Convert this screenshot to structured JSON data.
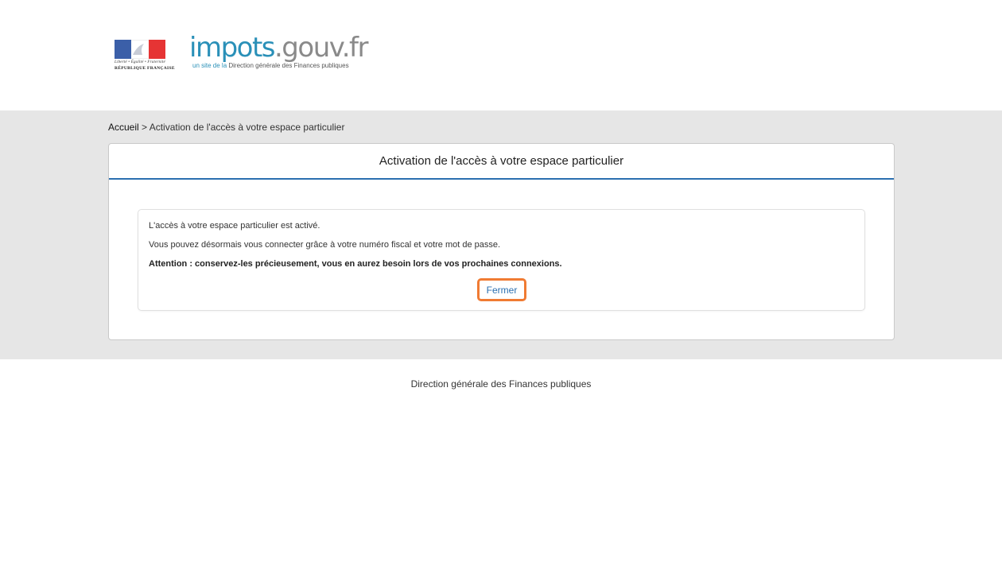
{
  "header": {
    "gov_motto": "Liberté • Égalité • Fraternité",
    "gov_name": "RÉPUBLIQUE FRANÇAISE",
    "site_name_part1": "impots",
    "site_name_part2": ".gouv.fr",
    "tagline_part1": "un site de la ",
    "tagline_part2": "Direction générale des Finances publiques"
  },
  "breadcrumb": {
    "home": "Accueil",
    "separator": " > ",
    "current": "Activation de l'accès à votre espace particulier"
  },
  "panel": {
    "title": "Activation de l'accès à votre espace particulier",
    "line1": "L'accès à votre espace particulier est activé.",
    "line2": "Vous pouvez désormais vous connecter grâce à votre numéro fiscal et votre mot de passe.",
    "line3": "Attention : conservez-les précieusement, vous en aurez besoin lors de vos prochaines connexions.",
    "close_label": "Fermer"
  },
  "footer": {
    "text": "Direction générale des Finances publiques"
  },
  "colors": {
    "accent_blue": "#2b6fb0",
    "focus_orange": "#f07b33",
    "band_gray": "#e6e6e6"
  }
}
